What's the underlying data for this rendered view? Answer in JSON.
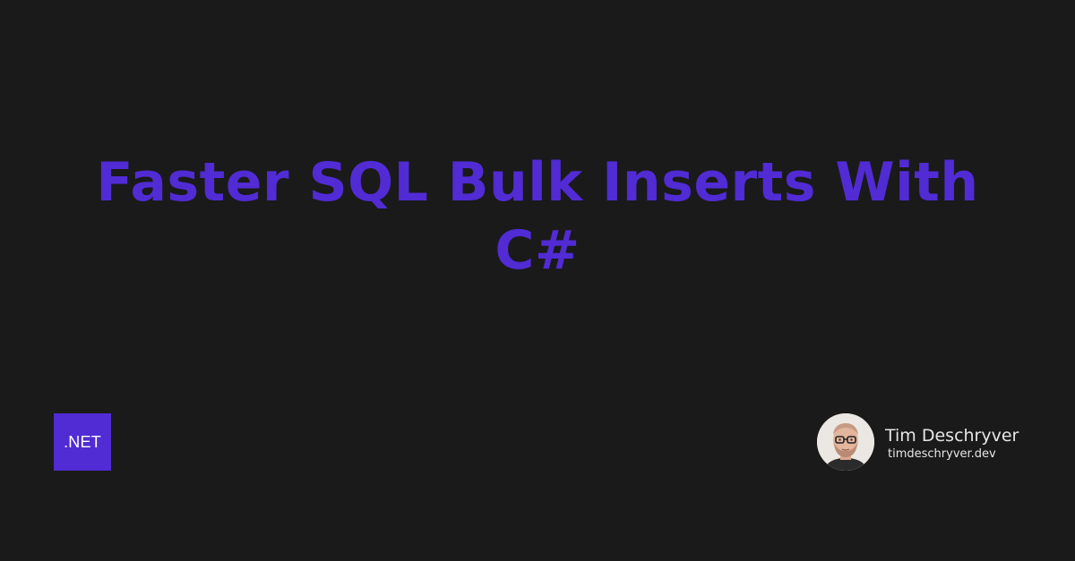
{
  "card": {
    "title": "Faster SQL Bulk Inserts With C#",
    "badge_label": ".NET",
    "author": {
      "name": "Tim Deschryver",
      "website": "timdeschryver.dev",
      "avatar_icon": "person-portrait-avatar"
    },
    "colors": {
      "background": "#1a1a1a",
      "accent": "#512bd4",
      "text": "#e6e6e6"
    }
  }
}
